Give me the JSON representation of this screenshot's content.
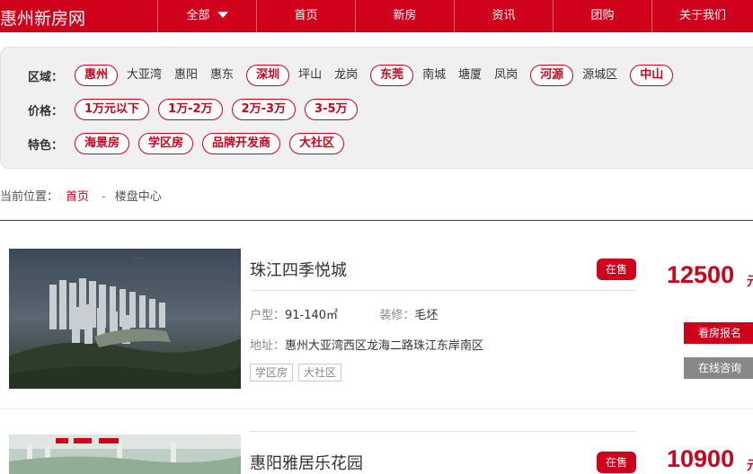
{
  "header": {
    "logo": "惠州新房网",
    "nav": [
      {
        "label": "全部",
        "dropdown": true
      },
      {
        "label": "首页"
      },
      {
        "label": "新房"
      },
      {
        "label": "资讯"
      },
      {
        "label": "团购"
      },
      {
        "label": "关于我们"
      }
    ]
  },
  "filters": {
    "region": {
      "label": "区域：",
      "items": [
        {
          "label": "惠州",
          "style": "chip"
        },
        {
          "label": "大亚湾",
          "style": "plain"
        },
        {
          "label": "惠阳",
          "style": "plain"
        },
        {
          "label": "惠东",
          "style": "plain"
        },
        {
          "label": "深圳",
          "style": "chip"
        },
        {
          "label": "坪山",
          "style": "plain"
        },
        {
          "label": "龙岗",
          "style": "plain"
        },
        {
          "label": "东莞",
          "style": "chip"
        },
        {
          "label": "南城",
          "style": "plain"
        },
        {
          "label": "塘厦",
          "style": "plain"
        },
        {
          "label": "凤岗",
          "style": "plain"
        },
        {
          "label": "河源",
          "style": "chip"
        },
        {
          "label": "源城区",
          "style": "plain"
        },
        {
          "label": "中山",
          "style": "chip"
        }
      ]
    },
    "price": {
      "label": "价格：",
      "items": [
        "1万元以下",
        "1万-2万",
        "2万-3万",
        "3-5万"
      ]
    },
    "feature": {
      "label": "特色：",
      "items": [
        "海景房",
        "学区房",
        "品牌开发商",
        "大社区"
      ]
    }
  },
  "breadcrumb": {
    "prefix": "当前位置：",
    "home": "首页",
    "sep": "-",
    "current": "楼盘中心"
  },
  "listings": [
    {
      "name": "珠江四季悦城",
      "status": "在售",
      "price": "12500",
      "unit": "元",
      "layout_label": "户型：",
      "layout_value": "91-140㎡",
      "deco_label": "装修：",
      "deco_value": "毛坯",
      "address_label": "地址：",
      "address_value": "惠州大亚湾西区龙海二路珠江东岸南区",
      "tags": [
        "学区房",
        "大社区"
      ],
      "btn_visit": "看房报名",
      "btn_consult": "在线咨询"
    },
    {
      "name": "惠阳雅居乐花园",
      "status": "在售",
      "price": "10900",
      "unit": "元"
    }
  ],
  "colors": {
    "brand": "#d0021b",
    "panel_bg": "#f0f0f0",
    "gray_button": "#888888"
  }
}
